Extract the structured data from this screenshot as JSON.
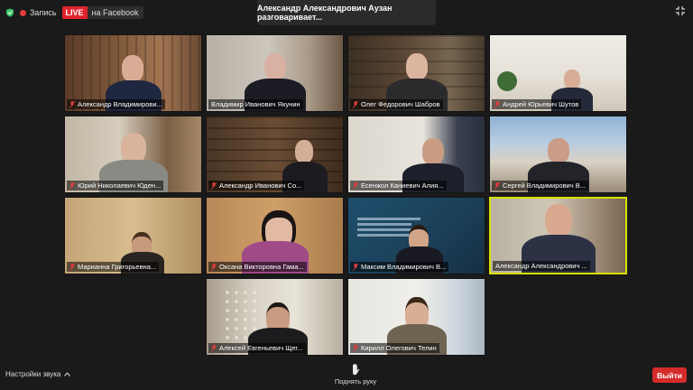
{
  "status": {
    "record_label": "Запись",
    "live_label": "LIVE",
    "stream_target": "на Facebook"
  },
  "speaker_banner": "Александр Александрович Аузан разговаривает...",
  "participants": [
    {
      "name": "Александр Владимирови..."
    },
    {
      "name": "Владимир Иванович Якунин"
    },
    {
      "name": "Олег Федорович Шабров"
    },
    {
      "name": "Андрей Юрьевич Шутов"
    },
    {
      "name": "Юрий Николаевич Юден..."
    },
    {
      "name": "Александр Иванович Со..."
    },
    {
      "name": "Есенжол Каниевич Алия..."
    },
    {
      "name": "Сергей Владимирович В..."
    },
    {
      "name": "Марианна Григорьевна..."
    },
    {
      "name": "Оксана Викторовна Гама..."
    },
    {
      "name": "Максим Владимирович В..."
    },
    {
      "name": "Александр Александрович ..."
    },
    {
      "name": "Алексей Евгеньевич Щег..."
    },
    {
      "name": "Кирилл Олегович Телин"
    }
  ],
  "controls": {
    "audio_settings": "Настройки звука",
    "raise_hand": "Поднять руку",
    "leave": "Выйти"
  },
  "colors": {
    "live": "#e0242b",
    "active_speaker_border": "#d6e000",
    "leave_button": "#d62b2b",
    "muted_mic": "#e03c3c"
  }
}
